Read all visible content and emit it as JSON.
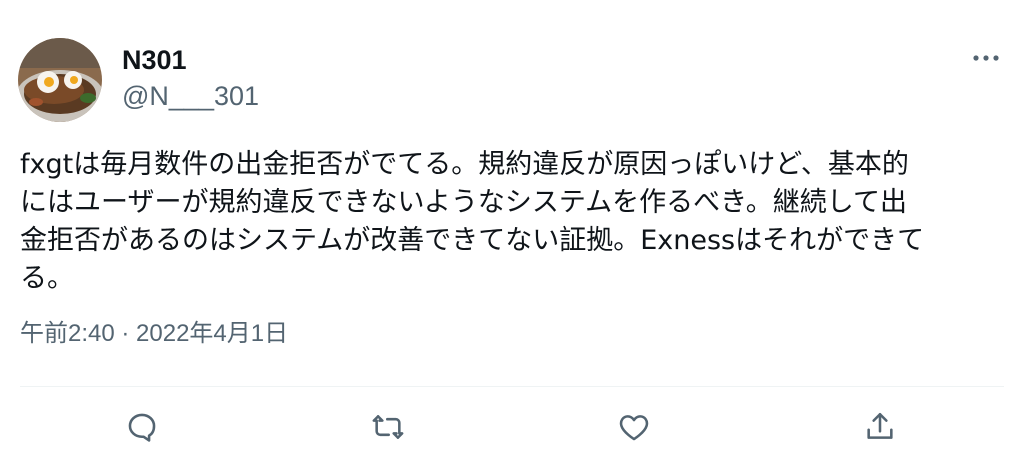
{
  "author": {
    "display_name": "N301",
    "handle": "@N___301",
    "avatar_icon": "food-plate-avatar"
  },
  "tweet": {
    "text": "fxgtは毎月数件の出金拒否がでてる。規約違反が原因っぽいけど、基本的\nにはユーザーが規約違反できないようなシステムを作るべき。継続して出\n金拒否があるのはシステムが改善できてない証拠。Exnessはそれができて\nる。",
    "timestamp": "午前2:40 · 2022年4月1日"
  },
  "actions": [
    {
      "name": "reply",
      "icon": "reply-icon"
    },
    {
      "name": "retweet",
      "icon": "retweet-icon"
    },
    {
      "name": "like",
      "icon": "heart-icon"
    },
    {
      "name": "share",
      "icon": "share-icon"
    }
  ],
  "colors": {
    "text": "#0f1419",
    "secondary": "#536471",
    "divider": "#eff3f4",
    "icon": "#536471"
  }
}
